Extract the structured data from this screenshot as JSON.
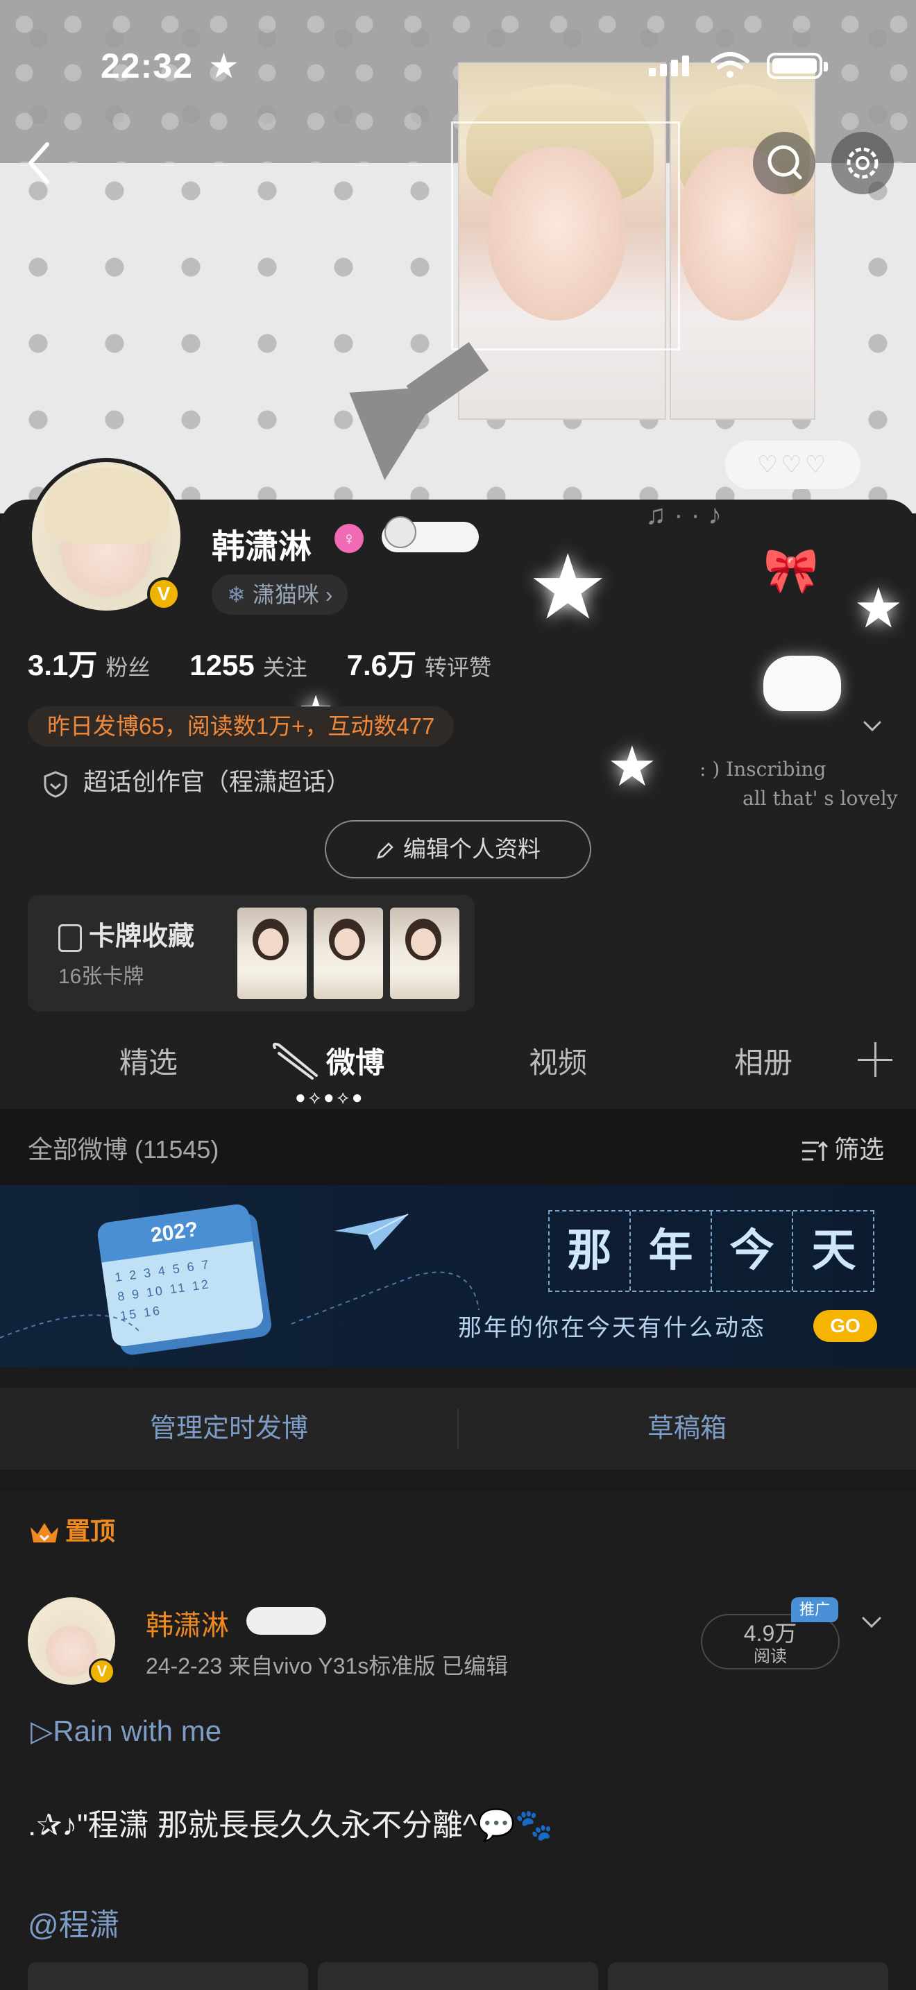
{
  "status_bar": {
    "time": "22:32"
  },
  "cover": {
    "bubble_hearts": "♡♡♡"
  },
  "profile": {
    "name": "韩潇淋",
    "verified_badge": "V",
    "gender_icon": "♀",
    "supertopic_label": "潇猫咪",
    "stats": [
      {
        "value": "3.1万",
        "label": "粉丝"
      },
      {
        "value": "1255",
        "label": "关注"
      },
      {
        "value": "7.6万",
        "label": "转评赞"
      }
    ],
    "highlight": "昨日发博65，阅读数1万+，互动数477",
    "certification": "超话创作官（程潇超话）",
    "edit_button": "编辑个人资料",
    "card_collection": {
      "title": "卡牌收藏",
      "count": "16张卡牌"
    },
    "deco_text_1": ": ) Inscribing",
    "deco_text_2": "all that' s lovely"
  },
  "tabs": [
    "精选",
    "微博",
    "视频",
    "相册"
  ],
  "active_tab": "微博",
  "tab_indicator": "●⟡●⟡●",
  "feed": {
    "count_label": "全部微博 (11545)",
    "filter_label": "筛选"
  },
  "banner": {
    "calendar_year": "202?",
    "calendar_days": "1 2 3 4 5 6 7\n8 9 10 11 12\n15 16",
    "title_chars": [
      "那",
      "年",
      "今",
      "天"
    ],
    "subtitle": "那年的你在今天有什么动态",
    "go_label": "GO"
  },
  "actions": {
    "scheduled": "管理定时发博",
    "drafts": "草稿箱"
  },
  "post": {
    "pinned_label": "置顶",
    "author": "韩潇淋",
    "verified_badge": "V",
    "meta": "24-2-23  来自vivo Y31s标准版  已编辑",
    "reads_value": "4.9万",
    "reads_label": "阅读",
    "promo_label": "推广",
    "music_line": "▷Rain with me",
    "text": ".✰♪\"程潇 那就長長久久永不分離^💬🐾",
    "mention": "@程潇"
  }
}
